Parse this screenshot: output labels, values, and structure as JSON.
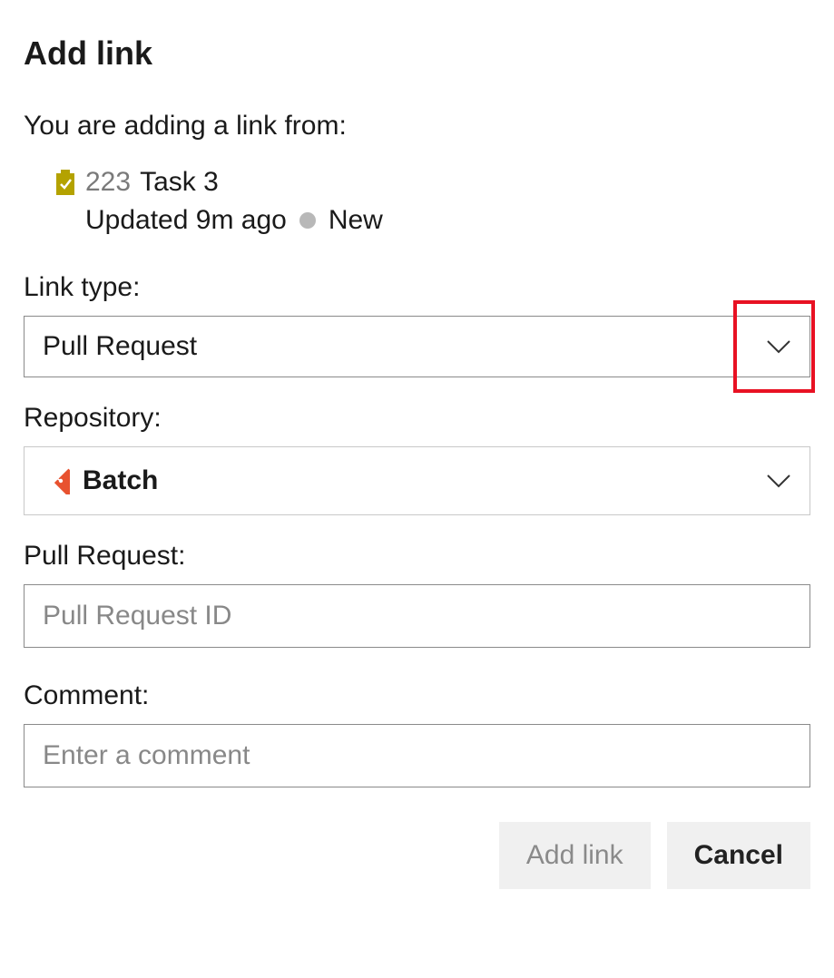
{
  "title": "Add link",
  "intro": "You are adding a link from:",
  "workItem": {
    "iconColor": "#b4a200",
    "id": "223",
    "title": "Task 3",
    "updated": "Updated 9m ago",
    "state": "New"
  },
  "fields": {
    "linkType": {
      "label": "Link type:",
      "value": "Pull Request"
    },
    "repository": {
      "label": "Repository:",
      "value": "Batch",
      "iconColor": "#e8522f"
    },
    "pullRequest": {
      "label": "Pull Request:",
      "placeholder": "Pull Request ID"
    },
    "comment": {
      "label": "Comment:",
      "placeholder": "Enter a comment"
    }
  },
  "buttons": {
    "addLink": "Add link",
    "cancel": "Cancel"
  }
}
